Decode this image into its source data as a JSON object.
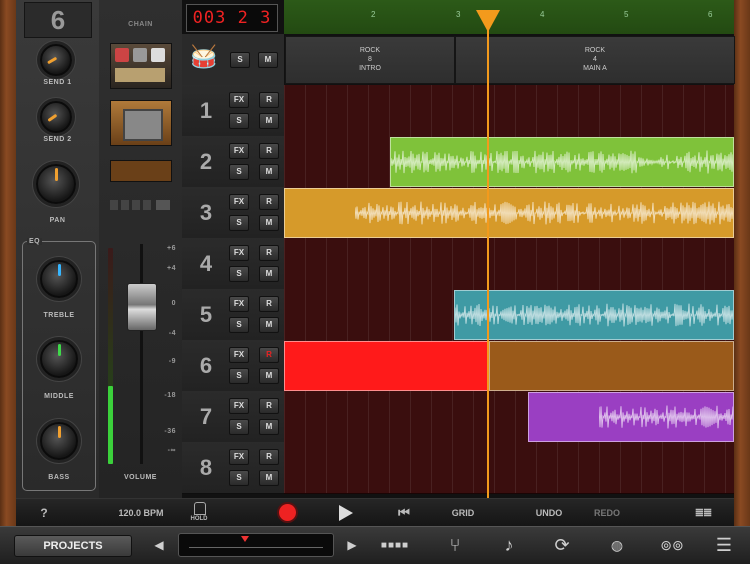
{
  "mixer": {
    "track_number": "6",
    "send1_label": "SEND 1",
    "send2_label": "SEND 2",
    "pan_label": "PAN",
    "eq_label": "EQ",
    "treble_label": "TREBLE",
    "middle_label": "MIDDLE",
    "bass_label": "BASS"
  },
  "chain": {
    "title": "CHAIN",
    "volume_label": "VOLUME",
    "fader_marks": [
      "+6",
      "+4",
      "0",
      "-4",
      "-9",
      "-18",
      "-36",
      "-∞"
    ]
  },
  "counter": {
    "bars": "003",
    "beat": "2",
    "sub": "3"
  },
  "ruler": {
    "marks": [
      "2",
      "3",
      "4",
      "5",
      "6"
    ]
  },
  "sections": [
    {
      "lines": [
        "ROCK",
        "8",
        "INTRO"
      ]
    },
    {
      "lines": [
        "ROCK",
        "4",
        "MAIN A"
      ]
    }
  ],
  "drum_row": {
    "s": "S",
    "m": "M"
  },
  "tracks": [
    {
      "num": "1",
      "fx": "FX",
      "r": "R",
      "s": "S",
      "m": "M"
    },
    {
      "num": "2",
      "fx": "FX",
      "r": "R",
      "s": "S",
      "m": "M"
    },
    {
      "num": "3",
      "fx": "FX",
      "r": "R",
      "s": "S",
      "m": "M"
    },
    {
      "num": "4",
      "fx": "FX",
      "r": "R",
      "s": "S",
      "m": "M"
    },
    {
      "num": "5",
      "fx": "FX",
      "r": "R",
      "s": "S",
      "m": "M"
    },
    {
      "num": "6",
      "fx": "FX",
      "r": "R",
      "s": "S",
      "m": "M"
    },
    {
      "num": "7",
      "fx": "FX",
      "r": "R",
      "s": "S",
      "m": "M"
    },
    {
      "num": "8",
      "fx": "FX",
      "r": "R",
      "s": "S",
      "m": "M"
    }
  ],
  "transport": {
    "help": "?",
    "bpm": "120.0 BPM",
    "hold": "HOLD",
    "grid": "GRID",
    "undo": "UNDO",
    "redo": "REDO"
  },
  "bottom": {
    "projects": "PROJECTS"
  },
  "colors": {
    "region2": "#7fc23a",
    "region3": "#d69a2a",
    "region5": "#3f9aa4",
    "region6": "#ff1a1a",
    "region7": "#9a3fc2",
    "playhead": "#f39a1c"
  }
}
